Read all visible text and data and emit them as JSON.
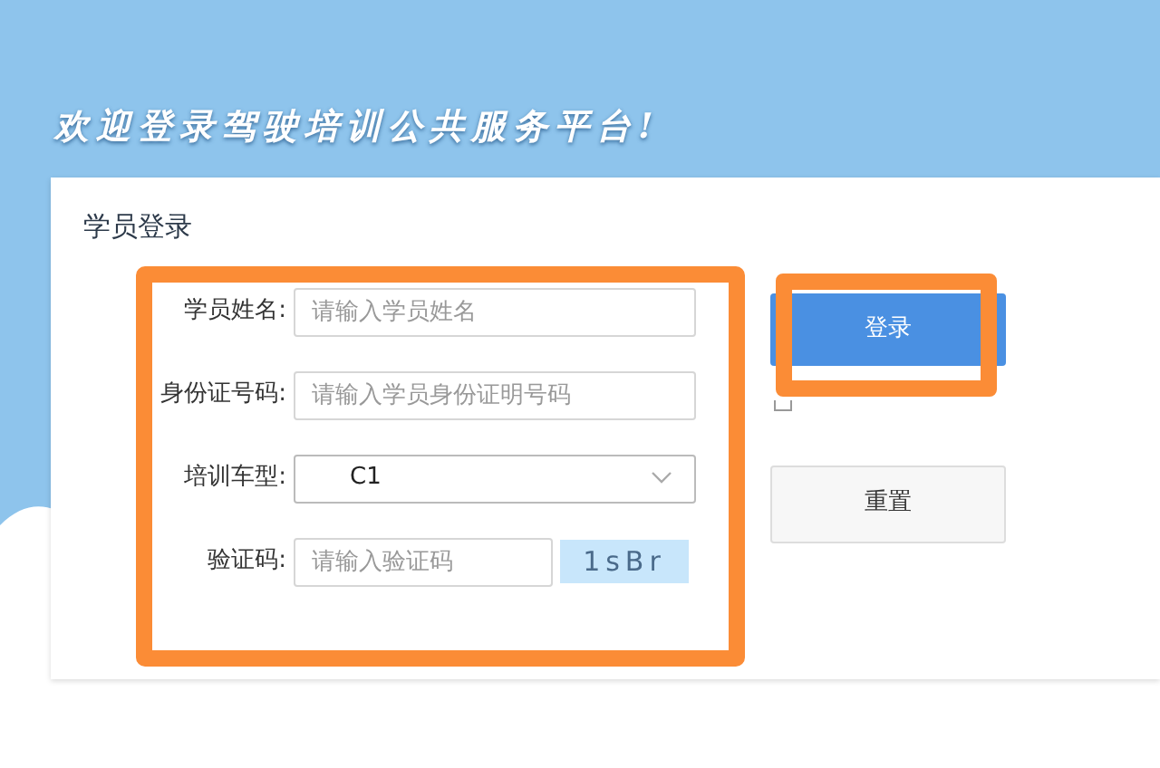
{
  "banner": {
    "title": "欢迎登录驾驶培训公共服务平台!"
  },
  "login_card": {
    "title": "学员登录",
    "fields": [
      {
        "kind": "input",
        "label": "学员姓名:",
        "placeholder": "请输入学员姓名"
      },
      {
        "kind": "input",
        "label": "身份证号码:",
        "placeholder": "请输入学员身份证明号码"
      },
      {
        "kind": "select",
        "label": "培训车型:",
        "value": "C1"
      },
      {
        "kind": "captcha",
        "label": "验证码:",
        "placeholder": "请输入验证码",
        "captcha": "1sBr"
      }
    ],
    "login_button": "登录",
    "remember": {
      "checked": false
    },
    "reset_button": "重置"
  }
}
